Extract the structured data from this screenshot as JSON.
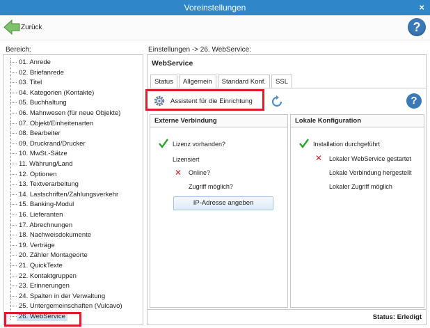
{
  "window": {
    "title": "Voreinstellungen",
    "close_glyph": "×"
  },
  "toolbar": {
    "back_label": "Zurück",
    "help_glyph": "?"
  },
  "labels": {
    "bereich": "Bereich:",
    "breadcrumb": "Einstellungen -> 26. WebService:"
  },
  "tree": {
    "items": [
      "01. Anrede",
      "02. Briefanrede",
      "03. Titel",
      "04. Kategorien (Kontakte)",
      "05. Buchhaltung",
      "06. Mahnwesen (für neue Objekte)",
      "07. Objekt/Einheitenarten",
      "08. Bearbeiter",
      "09. Druckrand/Drucker",
      "10. MwSt.-Sätze",
      "11. Währung/Land",
      "12. Optionen",
      "13. Textverarbeitung",
      "14. Lastschriften/Zahlungsverkehr",
      "15. Banking-Modul",
      "16. Lieferanten",
      "17. Abrechnungen",
      "18. Nachweisdokumente",
      "19. Verträge",
      "20. Zähler Montageorte",
      "21. QuickTexte",
      "22. Kontaktgruppen",
      "23. Erinnerungen",
      "24. Spalten in der Verwaltung",
      "25. Untergemeinschaften (Vulcavo)",
      "26. WebService"
    ],
    "selected_index": 25
  },
  "panel": {
    "title": "WebService",
    "tabs": [
      "Status",
      "Allgemein",
      "Standard Konf.",
      "SSL"
    ],
    "active_tab": "Status",
    "assistant_label": "Assistent für die Einrichtung",
    "help_glyph": "?",
    "external": {
      "heading": "Externe Verbindung",
      "license": "Lizenz vorhanden?",
      "licensed": "Lizensiert",
      "online": "Online?",
      "access": "Zugriff möglich?",
      "ip_button": "IP-Adresse angeben"
    },
    "local": {
      "heading": "Lokale Konfiguration",
      "install": "Installation durchgeführt",
      "started": "Lokaler WebService gestartet",
      "connection": "Lokale Verbindung hergestellt",
      "access": "Lokaler Zugriff möglich"
    },
    "status": "Status: Erledigt"
  },
  "colors": {
    "titlebar": "#2f86c8",
    "highlight": "#e21a2c",
    "check": "#2aa52a",
    "cross": "#dd2222",
    "help": "#3a78b8"
  }
}
